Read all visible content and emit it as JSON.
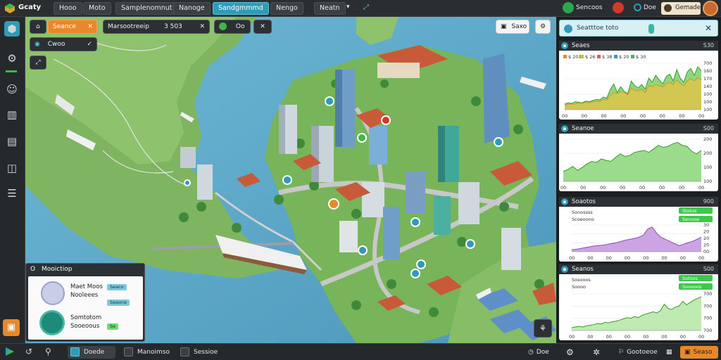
{
  "topbar": {
    "logo_text": "Gcaty",
    "buttons": [
      "Hooo",
      "Moto",
      "Samplenomnut",
      "Nanoge",
      "Sandgmmmd",
      "Nengo",
      "Neatn"
    ],
    "active_index": 4,
    "right_items": [
      "Sencoos",
      "Doe",
      "Gemade"
    ]
  },
  "toolbar": {
    "chip_search": "Seance",
    "chip_coords": "Marsootreeip",
    "chip_coords_value": "3 503",
    "chip_label_three": "Oo",
    "chip_layer": "Cwoo",
    "chip_view": "Saxo"
  },
  "infocard": {
    "title": "Mooictiop",
    "title_prefix": "O",
    "row1_name": "Maet Moos",
    "row1_sub": "Nooleees",
    "row1_tag1": "Seaco",
    "row1_tag2": "Seaone",
    "row2_name": "Somtotom",
    "row2_sub": "Sooeoous",
    "row2_tag": "Se"
  },
  "right_panel": {
    "header_title": "Seatttoe toto",
    "charts": [
      {
        "title": "Seaes",
        "right": "S30",
        "legend": [
          "$ 201",
          "$ 26",
          "$ 38",
          "$ 20",
          "$ 30"
        ]
      },
      {
        "title": "Seanoe",
        "right": "S00"
      },
      {
        "title": "Soaotos",
        "right": "900",
        "badges": [
          "Stotos",
          "Senooe"
        ],
        "lines": [
          "Sonossss",
          "Scoeoono"
        ]
      },
      {
        "title": "Seanos",
        "right": "S00",
        "badges": [
          "Sotoos",
          "Sooooos"
        ],
        "lines": [
          "Sosooos",
          "Soooo"
        ]
      }
    ]
  },
  "bottombar": {
    "items": [
      "Doede",
      "Manoimso",
      "Sessioe"
    ],
    "right_items": [
      "Doe",
      "Gootoeoe",
      "Seaso"
    ]
  },
  "chart_data": [
    {
      "type": "area",
      "title": "Seaes",
      "x": [
        0,
        1,
        2,
        3,
        4,
        5,
        6,
        7,
        8,
        9,
        10,
        11,
        12,
        13,
        14,
        15,
        16,
        17,
        18,
        19,
        20,
        21,
        22,
        23,
        24,
        25,
        26,
        27,
        28,
        29,
        30,
        31,
        32,
        33,
        34,
        35,
        36,
        37,
        38,
        39
      ],
      "series": [
        {
          "values": [
            10,
            12,
            11,
            14,
            13,
            12,
            15,
            14,
            16,
            18,
            17,
            22,
            20,
            35,
            45,
            30,
            40,
            32,
            28,
            50,
            42,
            38,
            44,
            36,
            55,
            48,
            60,
            52,
            45,
            58,
            62,
            50,
            70,
            55,
            48,
            66,
            72,
            60,
            75,
            68
          ]
        },
        {
          "values": [
            8,
            9,
            10,
            10,
            12,
            11,
            13,
            12,
            14,
            15,
            14,
            18,
            17,
            25,
            30,
            28,
            32,
            30,
            26,
            38,
            34,
            33,
            36,
            30,
            42,
            40,
            44,
            42,
            40,
            46,
            48,
            44,
            52,
            46,
            42,
            50,
            54,
            50,
            56,
            52
          ]
        }
      ],
      "yticks": [
        "700",
        "160",
        "170",
        "140",
        "100",
        "100",
        "100"
      ],
      "xticks": [
        "00",
        "00",
        "00",
        "00",
        "00",
        "00",
        "00",
        "00"
      ]
    },
    {
      "type": "area",
      "title": "Seanoe",
      "x": [
        0,
        1,
        2,
        3,
        4,
        5,
        6,
        7,
        8,
        9,
        10,
        11,
        12,
        13,
        14,
        15,
        16,
        17,
        18,
        19,
        20,
        21,
        22,
        23,
        24,
        25,
        26,
        27,
        28,
        29
      ],
      "series": [
        {
          "values": [
            20,
            24,
            30,
            22,
            28,
            35,
            40,
            38,
            45,
            42,
            40,
            48,
            55,
            50,
            52,
            58,
            60,
            62,
            58,
            65,
            72,
            68,
            70,
            75,
            78,
            72,
            70,
            60,
            55,
            62
          ]
        }
      ],
      "yticks": [
        "200",
        "200",
        "100",
        "100"
      ],
      "xticks": [
        "00",
        "00",
        "00",
        "00",
        "00",
        "00",
        "00",
        "00"
      ]
    },
    {
      "type": "area",
      "title": "Soaotos",
      "x": [
        0,
        1,
        2,
        3,
        4,
        5,
        6,
        7,
        8,
        9,
        10,
        11,
        12,
        13,
        14,
        15,
        16,
        17,
        18,
        19,
        20,
        21,
        22,
        23,
        24,
        25,
        26,
        27,
        28,
        29
      ],
      "series": [
        {
          "values": [
            5,
            6,
            8,
            10,
            12,
            14,
            15,
            16,
            18,
            20,
            22,
            25,
            28,
            30,
            32,
            35,
            40,
            55,
            60,
            45,
            35,
            30,
            25,
            20,
            15,
            18,
            22,
            25,
            30,
            35
          ]
        }
      ],
      "yticks": [
        "30",
        "20",
        "20",
        "20",
        "00"
      ],
      "xticks": [
        "00",
        "00",
        "00",
        "00",
        "00",
        "00",
        "00",
        "00"
      ]
    },
    {
      "type": "area",
      "title": "Seanos",
      "x": [
        0,
        1,
        2,
        3,
        4,
        5,
        6,
        7,
        8,
        9,
        10,
        11,
        12,
        13,
        14,
        15,
        16,
        17,
        18,
        19,
        20,
        21,
        22,
        23,
        24,
        25,
        26,
        27,
        28,
        29,
        30,
        31,
        32,
        33,
        34,
        35
      ],
      "series": [
        {
          "values": [
            5,
            6,
            7,
            6,
            8,
            9,
            10,
            12,
            11,
            14,
            13,
            15,
            16,
            18,
            20,
            22,
            21,
            24,
            22,
            26,
            28,
            30,
            32,
            30,
            34,
            45,
            38,
            36,
            40,
            42,
            50,
            44,
            48,
            52,
            55,
            58
          ]
        }
      ],
      "yticks": [
        "700",
        "700",
        "700",
        "700"
      ],
      "xticks": [
        "00",
        "00",
        "00",
        "00",
        "00",
        "00",
        "00",
        "00"
      ]
    }
  ]
}
